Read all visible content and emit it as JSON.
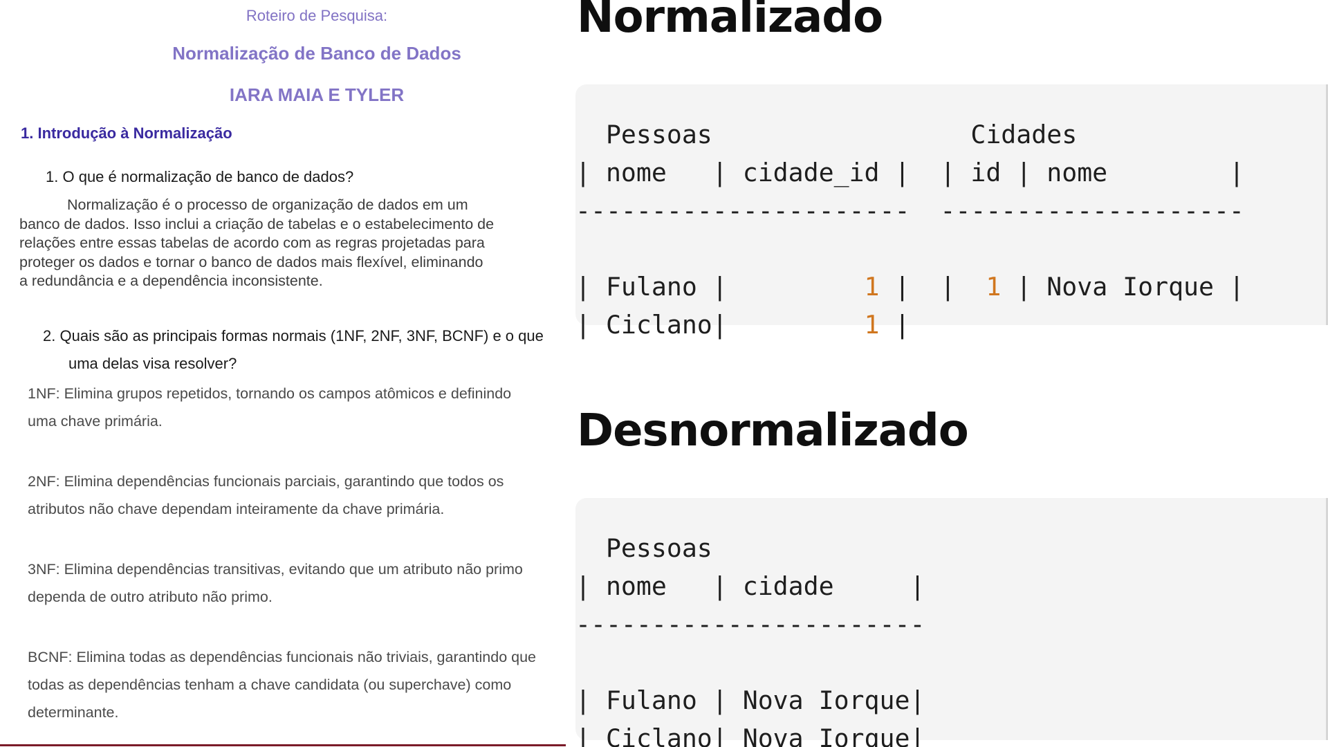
{
  "document": {
    "kicker": "Roteiro de Pesquisa:",
    "title": "Normalização de Banco de Dados",
    "authors": "IARA MAIA E TYLER",
    "section_heading": "1. Introdução à Normalização",
    "question1": {
      "number": "1.",
      "text": "O que é normalização de banco de dados?"
    },
    "answer1_lines": [
      "Normalização é o processo de organização de dados em um",
      "banco de dados. Isso inclui a criação de tabelas e o estabelecimento de",
      "relações entre essas tabelas de acordo com as regras projetadas para",
      "proteger os dados e tornar o banco de dados mais flexível, eliminando",
      "a redundância e a dependência inconsistente."
    ],
    "question2": {
      "number": "2.",
      "text": "Quais são as principais formas normais (1NF, 2NF, 3NF, BCNF) e o que",
      "continuation": "uma delas visa resolver?"
    },
    "nf1_lines": [
      "1NF: Elimina grupos repetidos, tornando os campos atômicos e definindo",
      "uma chave primária."
    ],
    "nf2_lines": [
      "2NF: Elimina dependências funcionais parciais, garantindo que todos os",
      "atributos não chave dependam inteiramente da chave primária."
    ],
    "nf3_lines": [
      "3NF: Elimina dependências transitivas, evitando que um atributo não primo",
      "dependa de outro atributo não primo."
    ],
    "bcnf_lines": [
      "BCNF: Elimina todas as dependências funcionais não triviais, garantindo que",
      "todas as dependências tenham a chave candidata (ou superchave) como",
      "determinante."
    ]
  },
  "normalizado": {
    "heading": "Normalizado",
    "pessoas_title": "Pessoas",
    "cidades_title": "Cidades",
    "pessoas_headers": [
      "nome",
      "cidade_id"
    ],
    "cidades_headers": [
      "id",
      "nome"
    ],
    "pessoas_rows": [
      {
        "nome": "Fulano",
        "cidade_id": "1"
      },
      {
        "nome": "Ciclano",
        "cidade_id": "1"
      }
    ],
    "cidades_rows": [
      {
        "id": "1",
        "nome": "Nova Iorque"
      }
    ]
  },
  "desnormalizado": {
    "heading": "Desnormalizado",
    "pessoas_title": "Pessoas",
    "headers": [
      "nome",
      "cidade"
    ],
    "rows": [
      {
        "nome": "Fulano",
        "cidade": "Nova Iorque"
      },
      {
        "nome": "Ciclano",
        "cidade": "Nova Iorque"
      }
    ]
  },
  "colors": {
    "title_purple": "#8274c6",
    "heading_indigo": "#3a2aa0",
    "number_orange": "#d0761e",
    "code_background": "#f4f4f4",
    "bottom_rule": "#7a1a28"
  }
}
